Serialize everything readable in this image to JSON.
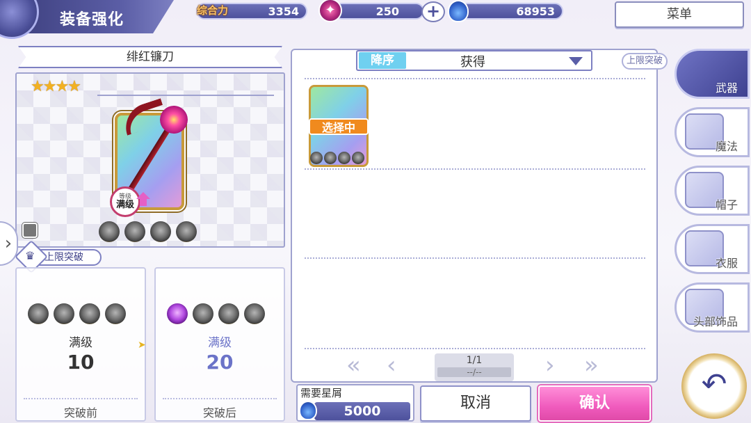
{
  "header": {
    "title": "装备强化",
    "power_label": "综合力",
    "power_value": "3354",
    "gems_value": "250",
    "plus_label": "+",
    "stardust_value": "68953",
    "menu_label": "菜单"
  },
  "item": {
    "name": "绯红镰刀",
    "stars": "★★★★",
    "star_count": 4,
    "level_badge_sub": "等级",
    "level_badge_main": "满级",
    "slots_filled": 0,
    "slots_total": 4
  },
  "limit_break": {
    "tag_label": "上限突破",
    "before": {
      "level_label": "满级",
      "level_value": "10",
      "footer": "突破前",
      "slots_filled": 0
    },
    "after": {
      "level_label": "满级",
      "level_value": "20",
      "footer": "突破后",
      "slots_filled": 1
    }
  },
  "list": {
    "sort_order_label": "降序",
    "sort_value": "获得",
    "filter_chip": "上限突破",
    "items": [
      {
        "selected_label": "选择中"
      }
    ],
    "page": "1/1",
    "page_sub": "--/--"
  },
  "categories": [
    {
      "label": "武器",
      "icon": "scythe-icon",
      "active": true
    },
    {
      "label": "魔法",
      "icon": "card-icon",
      "active": false
    },
    {
      "label": "帽子",
      "icon": "hat-icon",
      "active": false
    },
    {
      "label": "衣服",
      "icon": "clothes-icon",
      "active": false
    },
    {
      "label": "头部饰品",
      "icon": "glasses-icon",
      "active": false
    }
  ],
  "footer": {
    "cost_label": "需要星屑",
    "cost_value": "5000",
    "cancel_label": "取消",
    "confirm_label": "确认"
  },
  "colors": {
    "accent": "#4d519c",
    "confirm": "#f05bbd",
    "selected": "#f08a1e",
    "sort_order": "#6fd0f0",
    "after_level": "#6b73c8"
  }
}
